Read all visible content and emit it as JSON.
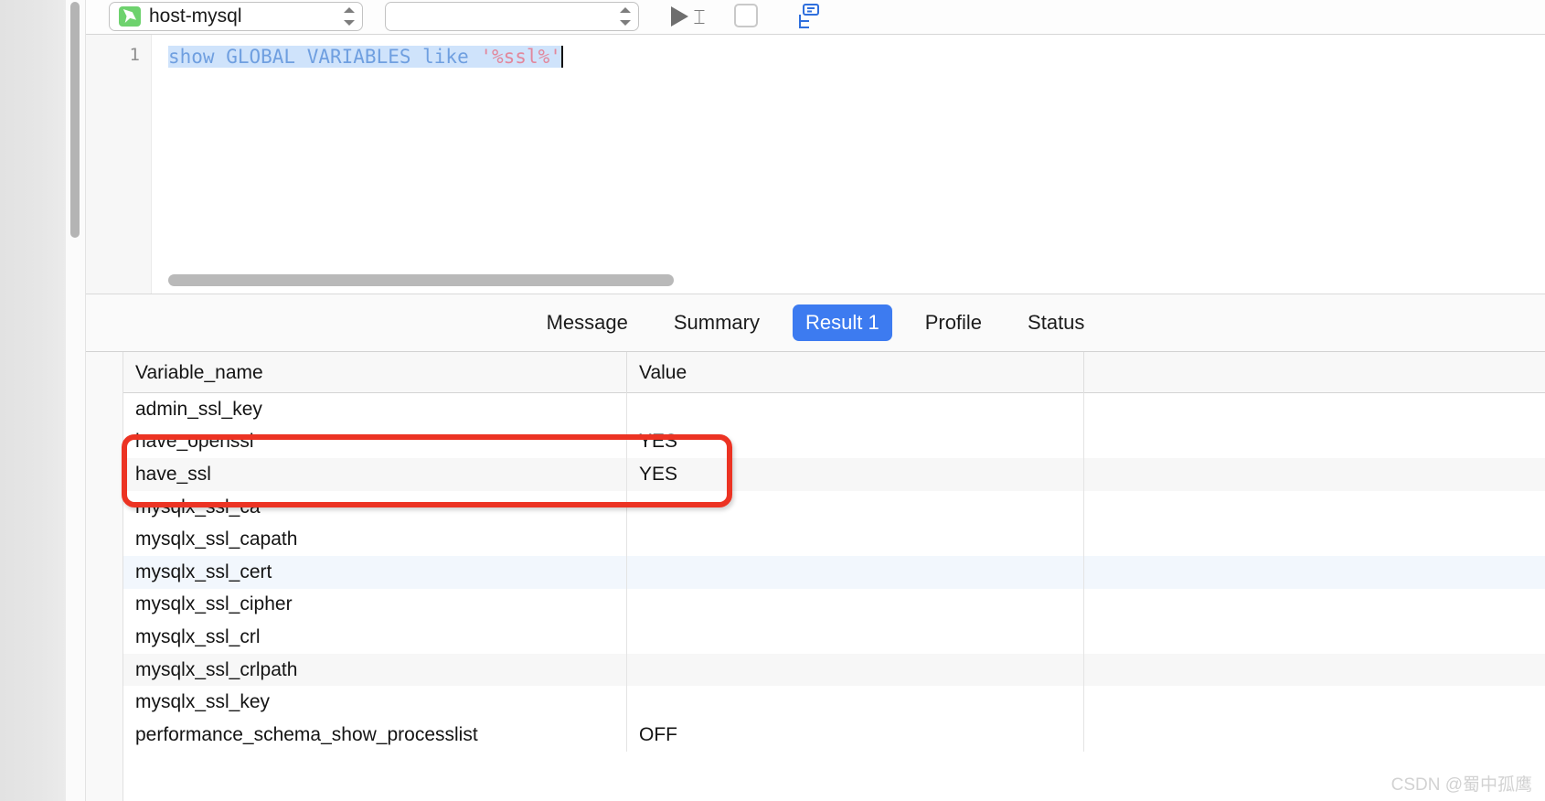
{
  "toolbar": {
    "connection": {
      "label": "host-mysql",
      "icon": "mysql-dolphin-icon"
    },
    "database": {
      "value": "",
      "placeholder": ""
    },
    "run_button": "run-icon",
    "ibeam": "⌶",
    "stop_button": "stop-icon",
    "explain_button": "explain-tree-icon"
  },
  "editor": {
    "line_number": "1",
    "query": {
      "part1": "show GLOBAL VARIABLES like ",
      "part2": "'%ssl%'"
    }
  },
  "tabs": [
    {
      "label": "Message",
      "active": false
    },
    {
      "label": "Summary",
      "active": false
    },
    {
      "label": "Result 1",
      "active": true
    },
    {
      "label": "Profile",
      "active": false
    },
    {
      "label": "Status",
      "active": false
    }
  ],
  "table": {
    "columns": [
      "Variable_name",
      "Value",
      ""
    ],
    "rows": [
      {
        "name": "admin_ssl_key",
        "value": "",
        "style": "plain"
      },
      {
        "name": "have_openssl",
        "value": "YES",
        "style": "plain"
      },
      {
        "name": "have_ssl",
        "value": "YES",
        "style": "alt"
      },
      {
        "name": "mysqlx_ssl_ca",
        "value": "",
        "style": "plain"
      },
      {
        "name": "mysqlx_ssl_capath",
        "value": "",
        "style": "plain"
      },
      {
        "name": "mysqlx_ssl_cert",
        "value": "",
        "style": "sel"
      },
      {
        "name": "mysqlx_ssl_cipher",
        "value": "",
        "style": "plain"
      },
      {
        "name": "mysqlx_ssl_crl",
        "value": "",
        "style": "plain"
      },
      {
        "name": "mysqlx_ssl_crlpath",
        "value": "",
        "style": "alt"
      },
      {
        "name": "mysqlx_ssl_key",
        "value": "",
        "style": "plain"
      },
      {
        "name": "performance_schema_show_processlist",
        "value": "OFF",
        "style": "plain"
      }
    ]
  },
  "annotation": {
    "shape": "rounded-rectangle",
    "color": "#ec3323"
  },
  "watermark": "CSDN @蜀中孤鹰"
}
